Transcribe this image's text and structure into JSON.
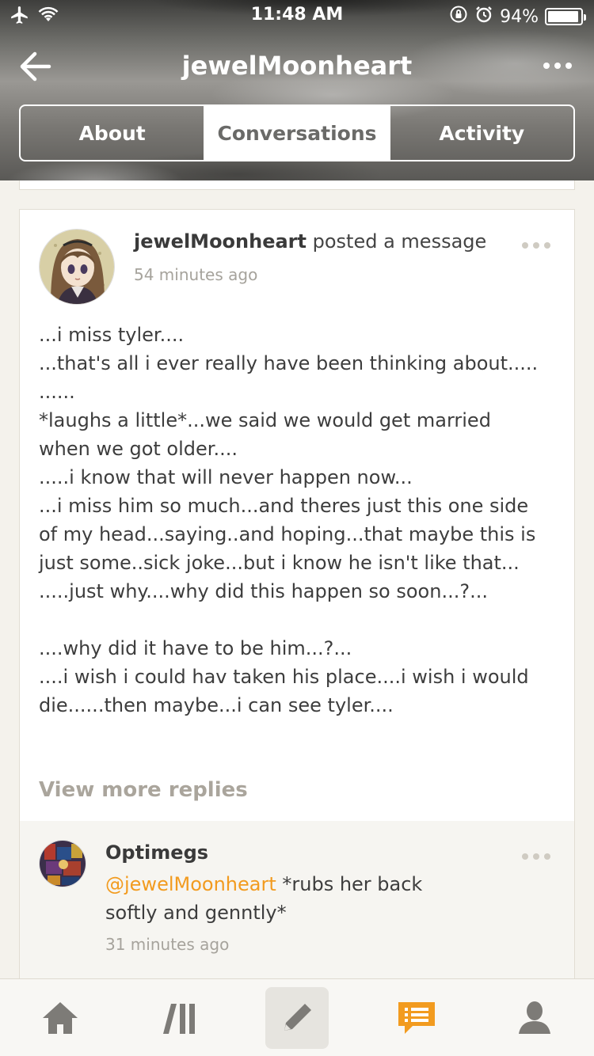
{
  "status_bar": {
    "time": "11:48 AM",
    "battery_percent": "94%",
    "battery_level": 0.94,
    "icons": [
      "airplane-icon",
      "wifi-icon",
      "orientation-lock-icon",
      "alarm-icon",
      "battery-icon"
    ]
  },
  "nav": {
    "title": "jewelMoonheart",
    "back_icon": "back-arrow-icon",
    "more_icon": "more-dots-icon"
  },
  "tabs": [
    {
      "label": "About",
      "active": false
    },
    {
      "label": "Conversations",
      "active": true
    },
    {
      "label": "Activity",
      "active": false
    }
  ],
  "post": {
    "author": "jewelMoonheart",
    "action": " posted a message",
    "time": "54 minutes ago",
    "body": "...i miss tyler....\n...that's all i ever really have been thinking about.....\n......\n*laughs a little*...we said we would get married when we got older....\n.....i know that will never happen now...\n...i miss him so much...and theres just this one side of my head...saying..and hoping...that maybe this is just some..sick joke...but i know he isn't like that...\n.....just why....why did this happen so soon...?...\n\n....why did it have to be him...?...\n....i wish i could hav taken his place....i wish i would die......then maybe...i can see tyler....",
    "view_more": "View more replies"
  },
  "reply": {
    "author": "Optimegs",
    "mention": "@jewelMoonheart",
    "text": " *rubs her back softly and genntly*",
    "time": "31 minutes ago"
  },
  "tabbar": {
    "items": [
      "home-icon",
      "feed-icon",
      "compose-icon",
      "messages-icon",
      "profile-icon"
    ],
    "active_color": "#f29b1f",
    "inactive_color": "#7d7b77"
  }
}
